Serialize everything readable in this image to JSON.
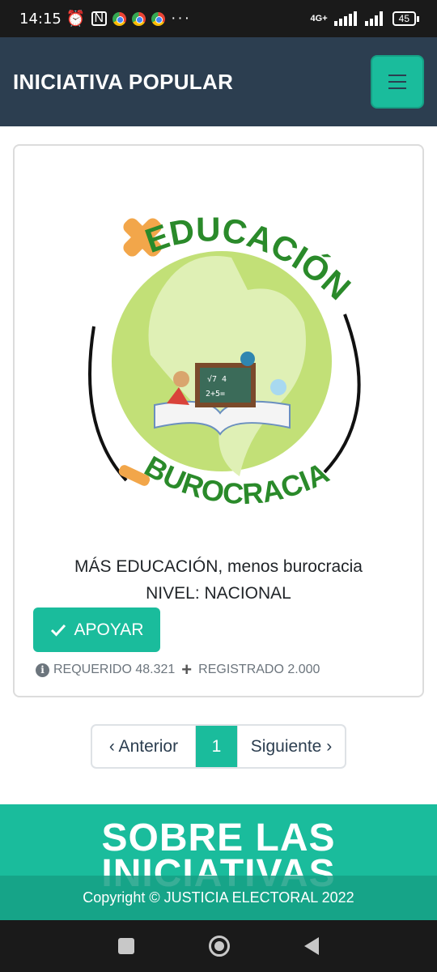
{
  "status_bar": {
    "time": "14:15",
    "network": "4G+",
    "battery": "45"
  },
  "navbar": {
    "brand": "INICIATIVA POPULAR"
  },
  "card": {
    "logo": {
      "top_text": "EDUCACIÓN",
      "bottom_text": "BUROCRACIA"
    },
    "title": "MÁS EDUCACIÓN, menos burocracia",
    "level": "NIVEL: NACIONAL",
    "support_button": "APOYAR",
    "required": "REQUERIDO 48.321",
    "registered": "REGISTRADO 2.000"
  },
  "pagination": {
    "prev": "‹ Anterior",
    "current": "1",
    "next": "Siguiente ›"
  },
  "about": {
    "title": "SOBRE LAS INICIATIVAS",
    "copyright": "Copyright © JUSTICIA ELECTORAL 2022"
  },
  "colors": {
    "navbar": "#2c3e50",
    "accent": "#1abc9c"
  }
}
